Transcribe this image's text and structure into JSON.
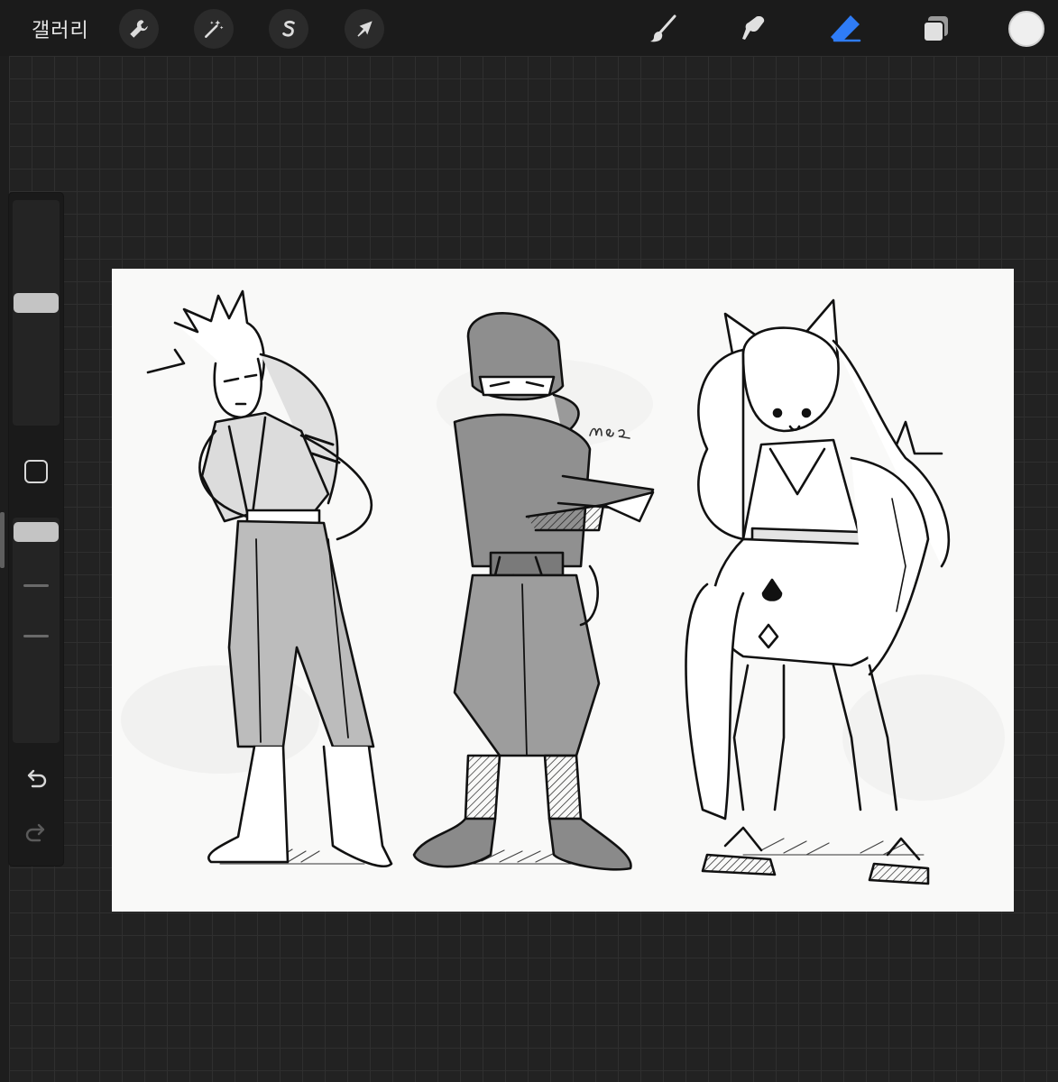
{
  "topbar": {
    "gallery_label": "갤러리",
    "left_tools": [
      {
        "icon": "wrench-icon",
        "name": "actions"
      },
      {
        "icon": "magic-wand-icon",
        "name": "adjustments"
      },
      {
        "icon": "selection-s-icon",
        "name": "selection"
      },
      {
        "icon": "arrow-cursor-icon",
        "name": "transform"
      }
    ],
    "right_tools": [
      {
        "icon": "brush-icon",
        "name": "paint"
      },
      {
        "icon": "smudge-icon",
        "name": "smudge"
      },
      {
        "icon": "eraser-icon",
        "name": "erase",
        "active": true
      },
      {
        "icon": "layers-icon",
        "name": "layers"
      }
    ],
    "color": "#efefef",
    "accent": "#2f7cf6"
  },
  "sidebar": {
    "brush_size_level": 0.55,
    "opacity_level": 0.98
  },
  "canvas": {
    "signature": "MSA"
  }
}
